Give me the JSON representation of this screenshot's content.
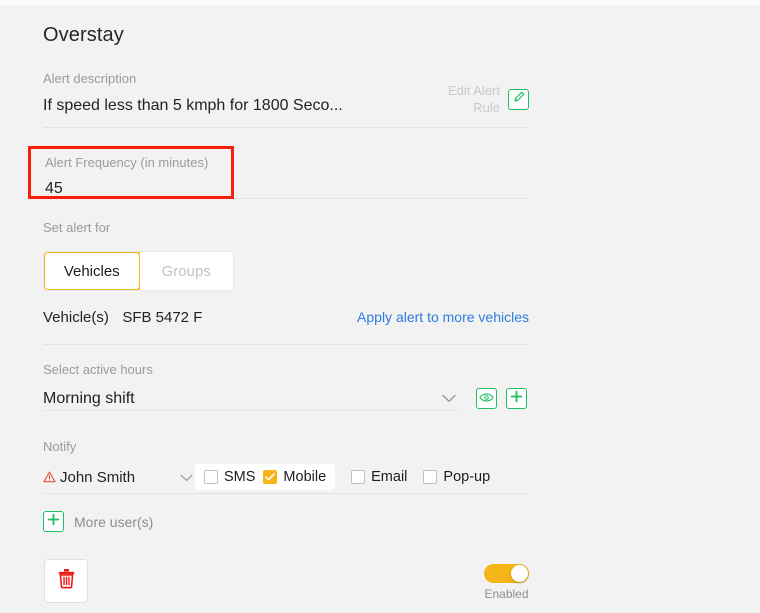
{
  "page": {
    "title": "Overstay"
  },
  "description": {
    "label": "Alert description",
    "value": "If speed less than 5 kmph for 1800 Seco...",
    "edit_rule_label": "Edit Alert Rule",
    "edit_icon": "pencil-icon"
  },
  "frequency": {
    "label": "Alert Frequency (in minutes)",
    "value": "45",
    "highlight_color": "#f61f0c"
  },
  "set_alert_for": {
    "label": "Set alert for",
    "tabs": [
      {
        "label": "Vehicles",
        "active": true
      },
      {
        "label": "Groups",
        "active": false
      }
    ],
    "active_tab_color": "#f2b718"
  },
  "vehicles": {
    "label": "Vehicle(s)",
    "value": "SFB 5472 F",
    "apply_link": "Apply alert to more vehicles",
    "link_color": "#2c7ddf"
  },
  "active_hours": {
    "label": "Select active hours",
    "value": "Morning shift",
    "chevron_icon": "chevron-down-icon",
    "preview_icon": "eye-icon",
    "add_icon": "plus-icon",
    "icon_color": "#1fbf62"
  },
  "notify": {
    "label": "Notify",
    "user": "John Smith",
    "user_warning_icon": "warning-triangle-icon",
    "chevron_icon": "chevron-down-icon",
    "channels": [
      {
        "label": "SMS",
        "checked": false,
        "grouped": true
      },
      {
        "label": "Mobile",
        "checked": true,
        "grouped": true
      },
      {
        "label": "Email",
        "checked": false,
        "grouped": false
      },
      {
        "label": "Pop-up",
        "checked": false,
        "grouped": false
      }
    ],
    "checked_color": "#f5b417",
    "more_users_label": "More user(s)",
    "more_users_icon": "plus-icon"
  },
  "footer": {
    "delete_icon": "trash-icon",
    "delete_color": "#ee1c16",
    "toggle_enabled": true,
    "toggle_label": "Enabled",
    "toggle_color": "#f5b417"
  }
}
